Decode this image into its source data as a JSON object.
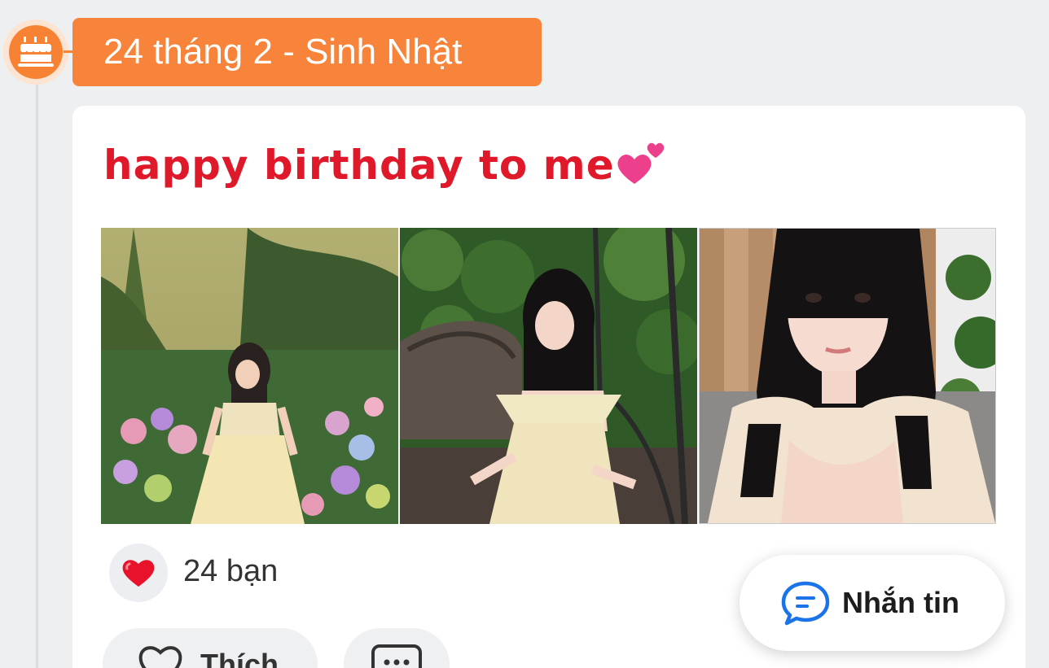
{
  "timeline": {
    "date_label": "24 tháng 2 - Sinh Nhật",
    "marker_icon": "birthday-cake-icon"
  },
  "post": {
    "text": "happy birthday to me",
    "emoji_icon": "two-hearts-icon",
    "photos": [
      {
        "label": "photo-garden"
      },
      {
        "label": "photo-swing"
      },
      {
        "label": "photo-selfie"
      }
    ],
    "reactions": {
      "icon": "heart-icon",
      "count_label": "24 bạn"
    },
    "actions": {
      "like_label": "Thích",
      "comment_icon": "comment-icon",
      "more_icon": "more-icon"
    }
  },
  "floating": {
    "message_label": "Nhắn tin",
    "message_icon": "chat-bubble-icon"
  },
  "colors": {
    "accent": "#f7843a",
    "post_text": "#e0192a",
    "heart": "#e8132b",
    "chat_icon": "#1a73e8",
    "background": "#eeeff1"
  }
}
